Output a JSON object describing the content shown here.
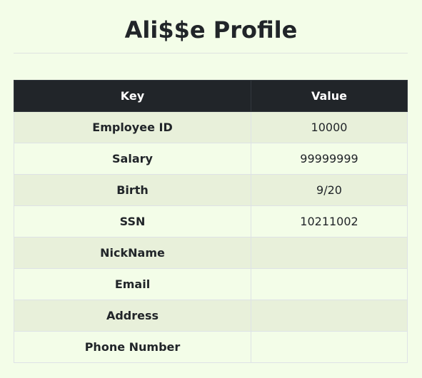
{
  "page": {
    "title": "Ali$$e Profile"
  },
  "table": {
    "headers": {
      "key": "Key",
      "value": "Value"
    },
    "rows": [
      {
        "key": "Employee ID",
        "value": "10000"
      },
      {
        "key": "Salary",
        "value": "99999999"
      },
      {
        "key": "Birth",
        "value": "9/20"
      },
      {
        "key": "SSN",
        "value": "10211002"
      },
      {
        "key": "NickName",
        "value": ""
      },
      {
        "key": "Email",
        "value": ""
      },
      {
        "key": "Address",
        "value": ""
      },
      {
        "key": "Phone Number",
        "value": ""
      }
    ]
  },
  "colors": {
    "background": "#f3fde8",
    "header_bg": "#212529",
    "stripe": "#e8f0da"
  }
}
